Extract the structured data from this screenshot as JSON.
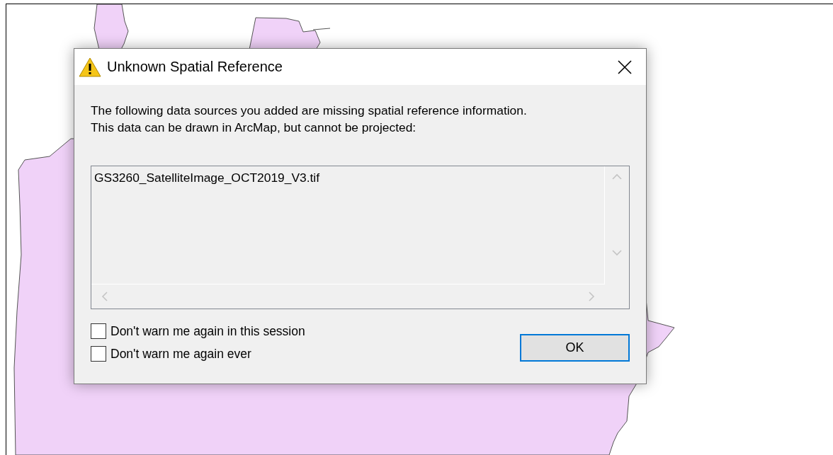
{
  "dialog": {
    "title": "Unknown Spatial Reference",
    "message": "The following data sources you added are missing spatial reference information.\nThis data can be drawn in ArcMap, but cannot be projected:",
    "sources": [
      "GS3260_SatelliteImage_OCT2019_V3.tif"
    ],
    "options": [
      {
        "label": "Don't warn me again in this session",
        "checked": false
      },
      {
        "label": "Don't warn me again ever",
        "checked": false
      }
    ],
    "ok_button": "OK"
  }
}
